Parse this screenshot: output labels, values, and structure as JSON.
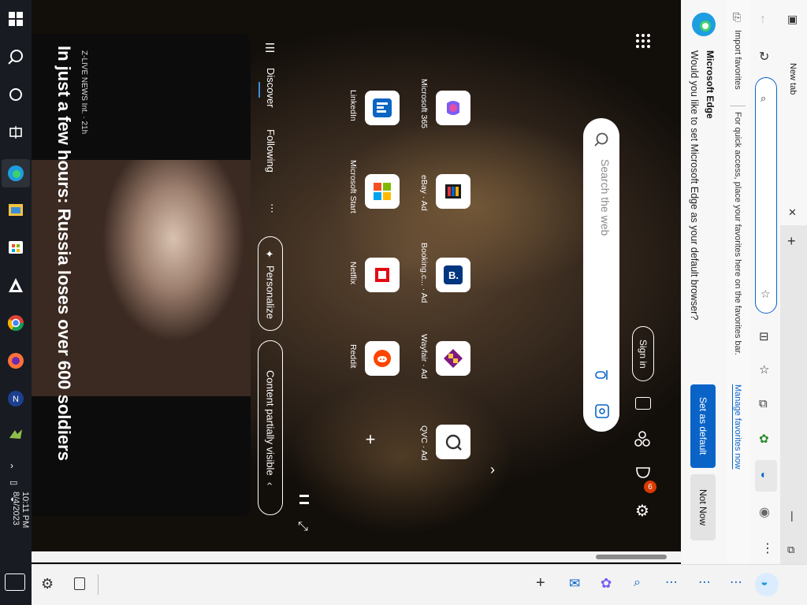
{
  "taskbar": {
    "clock_time": "10:11 PM",
    "clock_date": "8/4/2023"
  },
  "news": {
    "source": "Z-LIVE NEWS Int. · 21h",
    "headline": "In just a few hours: Russia loses over 600 soldiers"
  },
  "feed": {
    "tab_discover": "Discover",
    "tab_following": "Following",
    "more": "⋯",
    "personalize": "Personalize",
    "content_visibility": "Content partially visible"
  },
  "tiles": [
    {
      "label": "Microsoft 365",
      "icon": "microsoft-365-icon"
    },
    {
      "label": "eBay · Ad",
      "icon": "ebay-icon"
    },
    {
      "label": "Booking.c... · Ad",
      "icon": "booking-icon"
    },
    {
      "label": "Wayfair · Ad",
      "icon": "wayfair-icon"
    },
    {
      "label": "QVC · Ad",
      "icon": "qvc-icon"
    },
    {
      "label": "LinkedIn",
      "icon": "linkedin-icon"
    },
    {
      "label": "Microsoft Start",
      "icon": "microsoft-start-icon"
    },
    {
      "label": "Netflix",
      "icon": "netflix-icon"
    },
    {
      "label": "Reddit",
      "icon": "reddit-icon"
    }
  ],
  "search": {
    "placeholder": "Search the web"
  },
  "header": {
    "sign_in": "Sign in",
    "notifications_badge": "6"
  },
  "edge_prompt": {
    "app_name": "Microsoft Edge",
    "question": "Would you like to set Microsoft Edge as your default browser?",
    "set_default": "Set as default",
    "not_now": "Not Now"
  },
  "favorites_bar": {
    "import": "Import favorites",
    "hint": "For quick access, place your favorites here on the favorites bar.",
    "manage": "Manage favorites now"
  },
  "tabs": {
    "new_tab": "New tab"
  },
  "colors": {
    "edge_blue": "#0a64c8",
    "notification_red": "#d83b01"
  }
}
